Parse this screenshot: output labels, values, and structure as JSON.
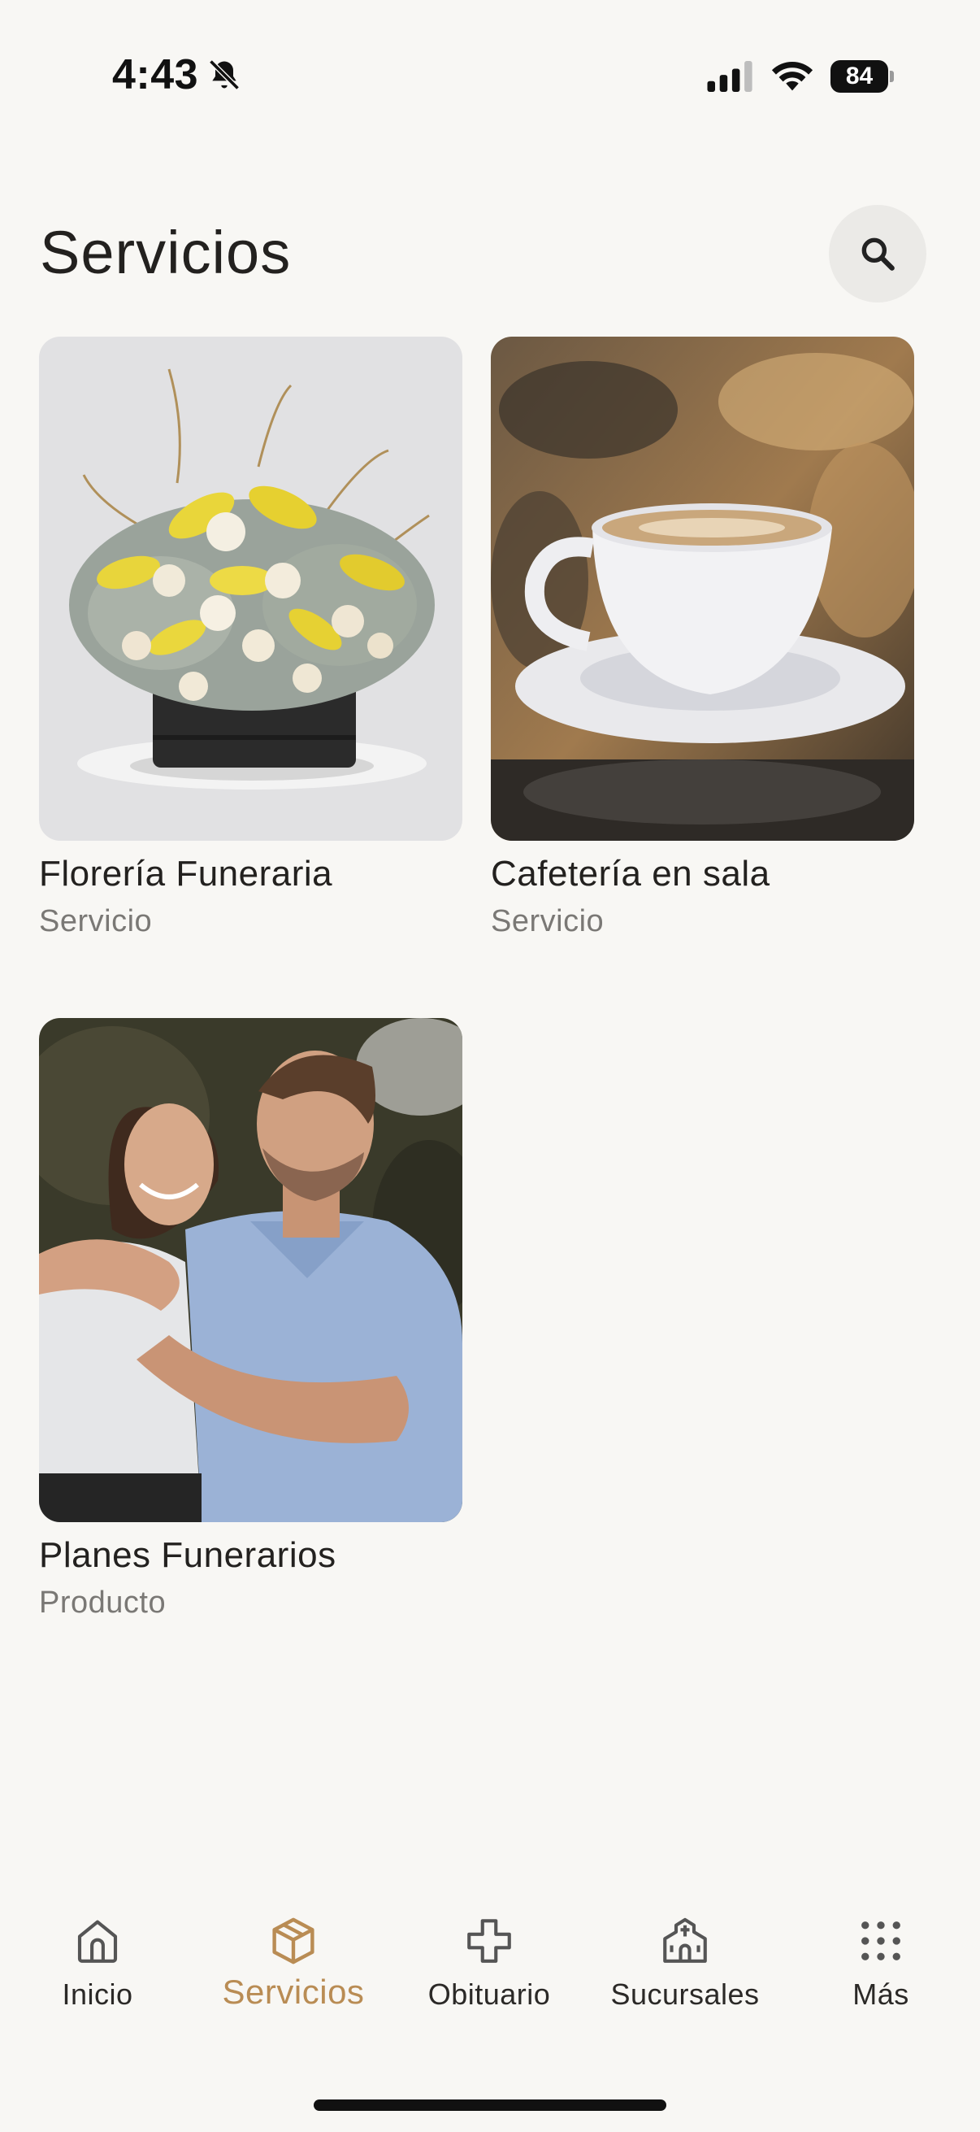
{
  "status_bar": {
    "time": "4:43",
    "battery": "84"
  },
  "header": {
    "title": "Servicios",
    "search_icon": "search-icon"
  },
  "cards": [
    {
      "title": "Florería Funeraria",
      "subtitle": "Servicio",
      "image": "flower-arrangement"
    },
    {
      "title": "Cafetería en sala",
      "subtitle": "Servicio",
      "image": "coffee-cup"
    },
    {
      "title": "Planes Funerarios",
      "subtitle": "Producto",
      "image": "couple-hugging"
    }
  ],
  "nav": {
    "items": [
      {
        "label": "Inicio",
        "icon": "home-icon"
      },
      {
        "label": "Servicios",
        "icon": "box-icon",
        "active": true
      },
      {
        "label": "Obituario",
        "icon": "cross-icon"
      },
      {
        "label": "Sucursales",
        "icon": "church-icon"
      },
      {
        "label": "Más",
        "icon": "grid-icon"
      }
    ]
  },
  "colors": {
    "background": "#f8f7f4",
    "accent": "#b98c54",
    "text": "#23211f",
    "muted": "#7a7875"
  }
}
